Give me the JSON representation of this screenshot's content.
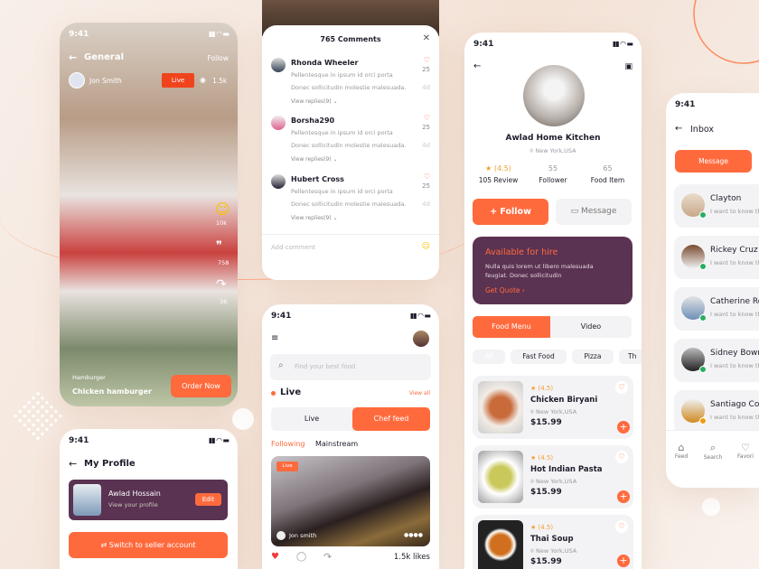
{
  "colors": {
    "accent": "#ff6a3d",
    "plum": "#5a3252",
    "online": "#27ae60",
    "away": "#f39c12"
  },
  "live_screen": {
    "time": "9:41",
    "title": "General",
    "follow": "Follow",
    "user": "Jon Smith",
    "live_badge": "Live",
    "views": "1.5k",
    "reactions": [
      {
        "icon": "smile-icon",
        "count": "10k"
      },
      {
        "icon": "chat-icon",
        "count": "758"
      },
      {
        "icon": "share-icon",
        "count": "36"
      }
    ],
    "category": "Hamburger",
    "dish": "Chicken hamburger",
    "order": "Order Now"
  },
  "profile_screen": {
    "time": "9:41",
    "title": "My Profile",
    "name": "Awlad Hossain",
    "sub": "View your profile",
    "edit": "Edit",
    "switch": "Switch to seller account"
  },
  "comments": {
    "title": "765 Comments",
    "items": [
      {
        "name": "Rhonda Wheeler",
        "line1": "Pellentesque in ipsum id orci porta",
        "line2": "Donec sollicitudin molestie malesuada.",
        "replies": "View replies(9)",
        "likes": "25",
        "age": "4d"
      },
      {
        "name": "Borsha290",
        "line1": "Pellentesque in ipsum id orci porta",
        "line2": "Donec sollicitudin molestie malesuada.",
        "replies": "View replies(9)",
        "likes": "25",
        "age": "4d"
      },
      {
        "name": "Hubert Cross",
        "line1": "Pellentesque in ipsum id orci porta",
        "line2": "Donec sollicitudin molestie malesuada.",
        "replies": "View replies(9)",
        "likes": "25",
        "age": "4d"
      }
    ],
    "add_placeholder": "Add comment"
  },
  "feed": {
    "time": "9:41",
    "search_placeholder": "Find your best food",
    "section": "Live",
    "view_all": "View all",
    "seg": [
      "Live",
      "Chef feed"
    ],
    "tabs": [
      "Following",
      "Mainstream"
    ],
    "card_badge": "Live",
    "card_user": "Jon smith",
    "likes": "1.5k likes"
  },
  "kitchen": {
    "time": "9:41",
    "name": "Awlad Home Kitchen",
    "location": "New York,USA",
    "stats": [
      {
        "value": "★ (4.5)",
        "label": "105 Review"
      },
      {
        "value": "55",
        "label": "Follower"
      },
      {
        "value": "65",
        "label": "Food Item"
      }
    ],
    "follow": "+ Follow",
    "message": "Message",
    "hire": {
      "title": "Available for hire",
      "text": "Nulla quis lorem ut libero malesuada feugiat. Donec sollicitudin",
      "cta": "Get Quote ›"
    },
    "seg": [
      "Food Menu",
      "Video"
    ],
    "chips": [
      "All",
      "Fast Food",
      "Pizza",
      "Th"
    ],
    "foods": [
      {
        "rating": "★ (4.5)",
        "name": "Chicken Biryani",
        "loc": "New York,USA",
        "price": "$15.99"
      },
      {
        "rating": "★ (4.5)",
        "name": "Hot Indian Pasta",
        "loc": "New York,USA",
        "price": "$15.99"
      },
      {
        "rating": "★ (4.5)",
        "name": "Thai Soup",
        "loc": "New York,USA",
        "price": "$15.99"
      }
    ]
  },
  "inbox": {
    "time": "9:41",
    "title": "Inbox",
    "tab": "Message",
    "items": [
      {
        "name": "Clayton",
        "preview": "I want to know th",
        "status": "online"
      },
      {
        "name": "Rickey Cruz",
        "preview": "I want to know th",
        "status": "online"
      },
      {
        "name": "Catherine Ro",
        "preview": "I want to know th",
        "status": "online"
      },
      {
        "name": "Sidney Bowm",
        "preview": "I want to know th",
        "status": "online"
      },
      {
        "name": "Santiago Col",
        "preview": "I want to know th",
        "status": "away"
      }
    ],
    "nav": [
      "Feed",
      "Search",
      "Favori"
    ]
  }
}
